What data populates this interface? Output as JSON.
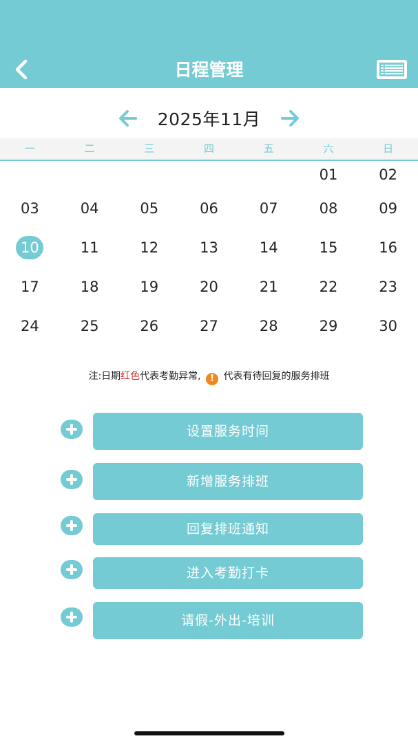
{
  "header": {
    "title": "日程管理",
    "back_icon": "chevron-left-icon",
    "menu_icon": "list-icon",
    "background": "#75cbd3"
  },
  "calendar": {
    "month_label": "2025年11月",
    "prev_icon": "arrow-left-icon",
    "next_icon": "arrow-right-icon",
    "weekdays": [
      "一",
      "二",
      "三",
      "四",
      "五",
      "六",
      "日"
    ],
    "weeks": [
      [
        "",
        "",
        "",
        "",
        "",
        "01",
        "02"
      ],
      [
        "03",
        "04",
        "05",
        "06",
        "07",
        "08",
        "09"
      ],
      [
        "10",
        "11",
        "12",
        "13",
        "14",
        "15",
        "16"
      ],
      [
        "17",
        "18",
        "19",
        "20",
        "21",
        "22",
        "23"
      ],
      [
        "24",
        "25",
        "26",
        "27",
        "28",
        "29",
        "30"
      ]
    ],
    "selected_day": "10"
  },
  "note": {
    "prefix": "注:日期",
    "red_text": "红色",
    "middle": "代表考勤异常,",
    "icon_glyph": "!",
    "suffix": "代表有待回复的服务排班"
  },
  "actions": [
    {
      "label": "设置服务时间",
      "icon": "plus-icon"
    },
    {
      "label": "新增服务排班",
      "icon": "plus-icon"
    },
    {
      "label": "回复排班通知",
      "icon": "plus-icon"
    },
    {
      "label": "进入考勤打卡",
      "icon": "plus-icon"
    },
    {
      "label": "请假-外出-培训",
      "icon": "plus-icon"
    }
  ],
  "colors": {
    "accent": "#75cbd3",
    "warning": "#f08a1c",
    "abnormal": "#d42a1c"
  }
}
